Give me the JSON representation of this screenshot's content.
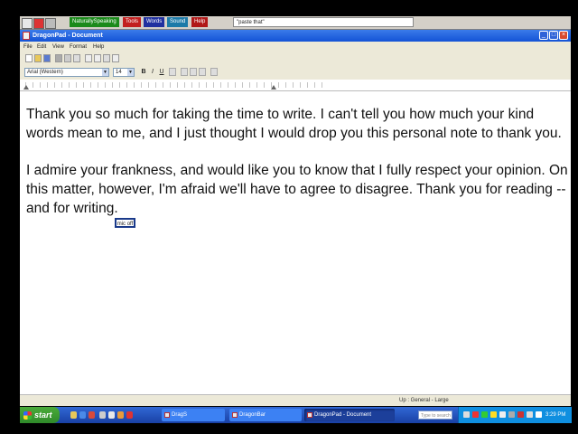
{
  "dragon_bar": {
    "menus": [
      {
        "label": "NaturallySpeaking",
        "color": "#1b8a1b"
      },
      {
        "label": "Tools",
        "color": "#c22020"
      },
      {
        "label": "Words",
        "color": "#2030a0"
      },
      {
        "label": "Sound",
        "color": "#1c7aa8"
      },
      {
        "label": "Help",
        "color": "#b01818"
      }
    ],
    "status_text": "\"paste that\""
  },
  "window": {
    "title": "DragonPad - Document",
    "menu": [
      "File",
      "Edit",
      "View",
      "Format",
      "Help"
    ],
    "font_name": "Arial (Western)",
    "font_size": "14",
    "format_buttons": {
      "bold": "B",
      "italic": "I",
      "underline": "U"
    }
  },
  "document": {
    "paragraphs": [
      "Thank you so much for taking the time to write.  I can't tell you how much your kind words mean to me, and I just thought I would drop you this personal note to thank you.",
      "I admire your frankness, and would like you to know that I fully respect your opinion. On this matter, however, I'm afraid we'll have to agree to disagree.  Thank you for reading -- and for writing."
    ]
  },
  "tooltip_text": "mic off",
  "status_bar": "Up : General - Large",
  "taskbar": {
    "start_label": "start",
    "tasks": [
      "DragS",
      "DragonBar",
      "DragonPad - Document"
    ],
    "search_placeholder": "Type to search",
    "clock": "3:29 PM"
  },
  "colors": {
    "titlebar": "#1f5fe0",
    "taskbar": "#245edb",
    "start_button": "#3c9a30"
  }
}
